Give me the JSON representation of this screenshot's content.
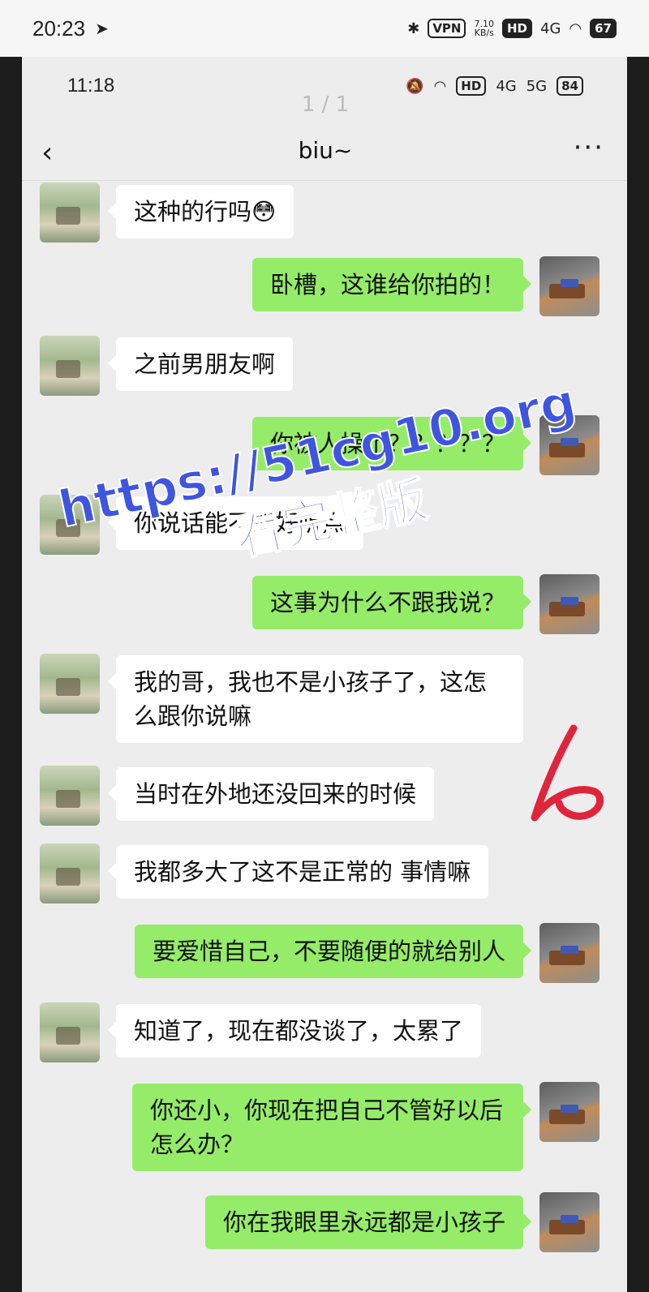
{
  "outer_status": {
    "time": "20:23",
    "send_icon": "telegram-send-icon",
    "vpn": "VPN",
    "speed_value": "7.10",
    "speed_unit": "KB/s",
    "hd": "HD",
    "network": "4G",
    "battery": "67"
  },
  "inner_status": {
    "time": "11:18",
    "hd": "HD",
    "network1": "4G",
    "network2": "5G",
    "battery": "84"
  },
  "page_indicator": "1 / 1",
  "header": {
    "title": "biu~",
    "back_icon": "back-chevron-icon",
    "more_icon": "more-dots-icon"
  },
  "messages": [
    {
      "side": "left",
      "text": "这种的行吗😳"
    },
    {
      "side": "right",
      "text": "卧槽，这谁给你拍的！"
    },
    {
      "side": "left",
      "text": "之前男朋友啊"
    },
    {
      "side": "right",
      "text": "你被人操了？？？？？"
    },
    {
      "side": "left",
      "text": "你说话能不能好听点"
    },
    {
      "side": "right",
      "text": "这事为什么不跟我说？"
    },
    {
      "side": "left",
      "text": "我的哥，我也不是小孩子了，这怎么跟你说嘛"
    },
    {
      "side": "left",
      "text": "当时在外地还没回来的时候"
    },
    {
      "side": "left",
      "text": "我都多大了这不是正常的 事情嘛"
    },
    {
      "side": "right",
      "text": "要爱惜自己，不要随便的就给别人"
    },
    {
      "side": "left",
      "text": "知道了，现在都没谈了，太累了"
    },
    {
      "side": "right",
      "text": "你还小，你现在把自己不管好以后怎么办？"
    },
    {
      "side": "right",
      "text": "你在我眼里永远都是小孩子"
    }
  ],
  "watermark": {
    "url": "https://51cg10.org",
    "sub": "看完整版"
  },
  "colors": {
    "chat_bg": "#ededed",
    "bubble_self": "#95ec69",
    "bubble_other": "#ffffff",
    "watermark": "#3f55e0",
    "scribble": "#e0243c"
  }
}
